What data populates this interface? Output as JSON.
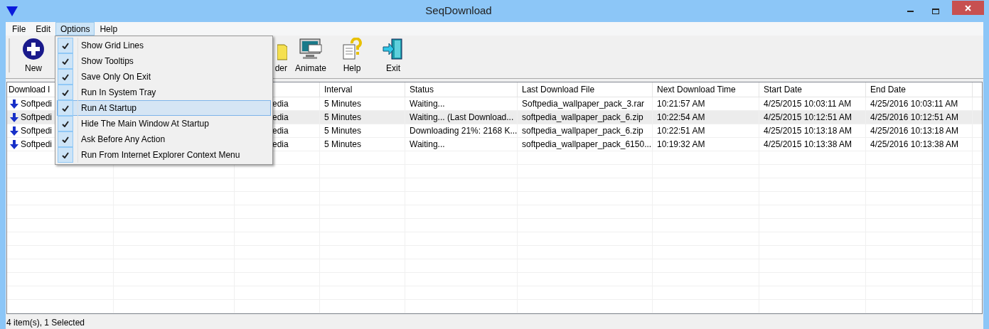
{
  "window": {
    "title": "SeqDownload"
  },
  "menubar": [
    {
      "label": "File",
      "selected": false
    },
    {
      "label": "Edit",
      "selected": false
    },
    {
      "label": "Options",
      "selected": true
    },
    {
      "label": "Help",
      "selected": false
    }
  ],
  "toolbar": [
    {
      "label": "New",
      "kind": "new"
    },
    {
      "label": "der",
      "kind": "folder"
    },
    {
      "label": "Animate",
      "kind": "animate"
    },
    {
      "label": "Help",
      "kind": "help"
    },
    {
      "label": "Exit",
      "kind": "exit"
    }
  ],
  "options_menu": [
    {
      "label": "Show Grid Lines",
      "checked": true,
      "selected": false
    },
    {
      "label": "Show Tooltips",
      "checked": true,
      "selected": false
    },
    {
      "label": "Save Only On Exit",
      "checked": true,
      "selected": false
    },
    {
      "label": "Run In System Tray",
      "checked": true,
      "selected": false
    },
    {
      "label": "Run At Startup",
      "checked": true,
      "selected": true
    },
    {
      "label": "Hide The Main Window At Startup",
      "checked": true,
      "selected": false
    },
    {
      "label": "Ask Before Any Action",
      "checked": true,
      "selected": false
    },
    {
      "label": "Run From Internet Explorer Context Menu",
      "checked": true,
      "selected": false
    }
  ],
  "table": {
    "columns": {
      "download": "Download I",
      "interval": "Interval",
      "status": "Status",
      "last_file": "Last Download File",
      "next_time": "Next Download Time",
      "start_date": "Start Date",
      "end_date": "End Date"
    },
    "rows": [
      {
        "download": "Softpedi",
        "column_3": "edia",
        "interval": "5 Minutes",
        "status": "Waiting...",
        "last_file": "Softpedia_wallpaper_pack_3.rar",
        "next_time": "10:21:57 AM",
        "start_date": "4/25/2015 10:03:11 AM",
        "end_date": "4/25/2016 10:03:11 AM",
        "selected": false
      },
      {
        "download": "Softpedi",
        "column_3": "edia",
        "interval": "5 Minutes",
        "status": "Waiting... (Last Download...",
        "last_file": "softpedia_wallpaper_pack_6.zip",
        "next_time": "10:22:54 AM",
        "start_date": "4/25/2015 10:12:51 AM",
        "end_date": "4/25/2016 10:12:51 AM",
        "selected": true
      },
      {
        "download": "Softpedi",
        "column_3": "edia",
        "interval": "5 Minutes",
        "status": "Downloading 21%: 2168 K...",
        "last_file": "softpedia_wallpaper_pack_6.zip",
        "next_time": "10:22:51 AM",
        "start_date": "4/25/2015 10:13:18 AM",
        "end_date": "4/25/2016 10:13:18 AM",
        "selected": false
      },
      {
        "download": "Softpedi",
        "column_3": "edia",
        "interval": "5 Minutes",
        "status": "Waiting...",
        "last_file": "softpedia_wallpaper_pack_6150...",
        "next_time": "10:19:32 AM",
        "start_date": "4/25/2015 10:13:38 AM",
        "end_date": "4/25/2016 10:13:38 AM",
        "selected": false
      }
    ]
  },
  "status_bar": "4 item(s), 1 Selected"
}
